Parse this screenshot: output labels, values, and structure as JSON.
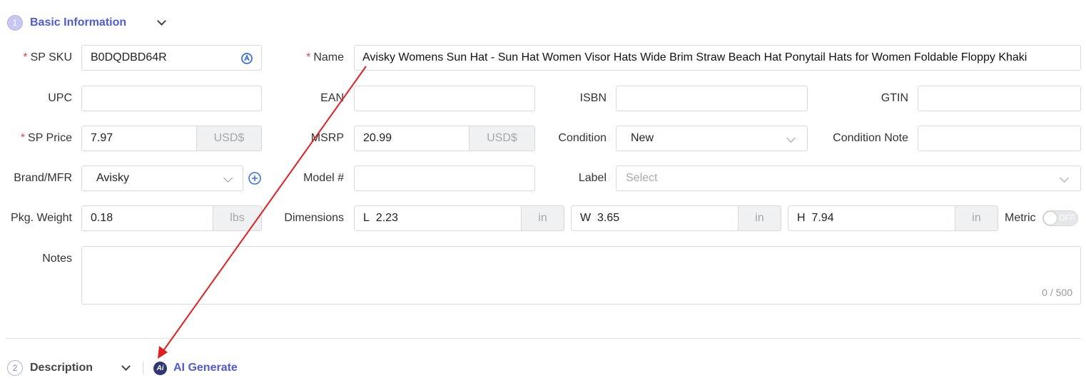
{
  "sections": {
    "basic": {
      "step": "1",
      "title": "Basic Information"
    },
    "description": {
      "step": "2",
      "title": "Description",
      "ai_label": "AI Generate",
      "ai_icon_text": "Ai"
    }
  },
  "fields": {
    "sp_sku": {
      "required": "*",
      "label": "SP SKU",
      "value": "B0DQDBD64R"
    },
    "name": {
      "required": "*",
      "label": "Name",
      "value": "Avisky Womens Sun Hat - Sun Hat Women Visor Hats Wide Brim Straw Beach Hat Ponytail Hats for Women Foldable Floppy Khaki"
    },
    "upc": {
      "label": "UPC",
      "value": ""
    },
    "ean": {
      "label": "EAN",
      "value": ""
    },
    "isbn": {
      "label": "ISBN",
      "value": ""
    },
    "gtin": {
      "label": "GTIN",
      "value": ""
    },
    "sp_price": {
      "required": "*",
      "label": "SP Price",
      "value": "7.97",
      "unit": "USD$"
    },
    "msrp": {
      "label": "MSRP",
      "value": "20.99",
      "unit": "USD$"
    },
    "condition": {
      "label": "Condition",
      "value": "New"
    },
    "condition_note": {
      "label": "Condition Note",
      "value": ""
    },
    "brand": {
      "label": "Brand/MFR",
      "value": "Avisky"
    },
    "model": {
      "label": "Model #",
      "value": ""
    },
    "label_field": {
      "label": "Label",
      "placeholder": "Select"
    },
    "pkg_weight": {
      "label": "Pkg. Weight",
      "value": "0.18",
      "unit": "lbs"
    },
    "dimensions": {
      "label": "Dimensions",
      "l_prefix": "L",
      "l_value": "2.23",
      "w_prefix": "W",
      "w_value": "3.65",
      "h_prefix": "H",
      "h_value": "7.94",
      "unit": "in"
    },
    "metric": {
      "label": "Metric",
      "toggle_text": "OFF"
    },
    "notes": {
      "label": "Notes",
      "counter": "0 / 500"
    }
  },
  "colors": {
    "accent": "#4f5bd5",
    "required": "#e5484d",
    "annotation": "#e02020"
  },
  "icons": [
    "chevron-down-icon",
    "scan-icon",
    "add-circle-icon",
    "ai-icon"
  ]
}
